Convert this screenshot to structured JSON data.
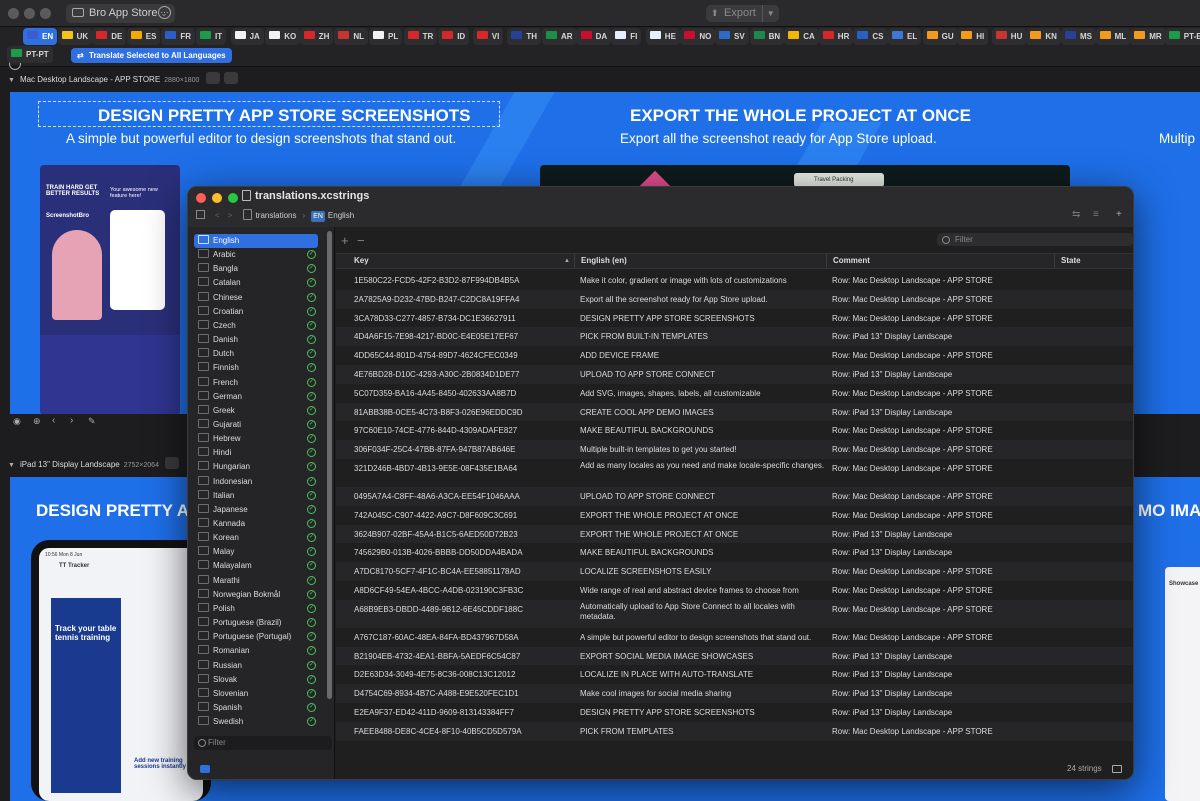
{
  "app": {
    "project_name": "Bro App Store",
    "export_label": "Export"
  },
  "languages": [
    {
      "code": "EN",
      "color": "#3c5bd0",
      "active": true
    },
    {
      "code": "UK",
      "color": "#f0c419"
    },
    {
      "code": "DE",
      "color": "#d62828"
    },
    {
      "code": "ES",
      "color": "#f2a900"
    },
    {
      "code": "FR",
      "color": "#2a5fc8"
    },
    {
      "code": "IT",
      "color": "#1c9c4a"
    },
    {
      "code": "JA",
      "color": "#f2f2f2"
    },
    {
      "code": "KO",
      "color": "#f2f2f2"
    },
    {
      "code": "ZH",
      "color": "#d62828"
    },
    {
      "code": "NL",
      "color": "#c8352f"
    },
    {
      "code": "PL",
      "color": "#f2f2f2"
    },
    {
      "code": "TR",
      "color": "#d62828"
    },
    {
      "code": "ID",
      "color": "#d62828"
    },
    {
      "code": "VI",
      "color": "#d62828"
    },
    {
      "code": "TH",
      "color": "#2a3f99"
    },
    {
      "code": "AR",
      "color": "#1c8f47"
    },
    {
      "code": "DA",
      "color": "#c8102e"
    },
    {
      "code": "FI",
      "color": "#e6eefc"
    },
    {
      "code": "HE",
      "color": "#e6eefc"
    },
    {
      "code": "NO",
      "color": "#c8102e"
    },
    {
      "code": "SV",
      "color": "#2a6cc8"
    },
    {
      "code": "BN",
      "color": "#1b8a4c"
    },
    {
      "code": "CA",
      "color": "#f2b705"
    },
    {
      "code": "HR",
      "color": "#d62828"
    },
    {
      "code": "CS",
      "color": "#2a5fc8"
    },
    {
      "code": "EL",
      "color": "#3d78d8"
    },
    {
      "code": "GU",
      "color": "#f29a1d"
    },
    {
      "code": "HI",
      "color": "#f29a1d"
    },
    {
      "code": "HU",
      "color": "#c8352f"
    },
    {
      "code": "KN",
      "color": "#f29a1d"
    },
    {
      "code": "MS",
      "color": "#2a3f99"
    },
    {
      "code": "ML",
      "color": "#f29a1d"
    },
    {
      "code": "MR",
      "color": "#f29a1d"
    },
    {
      "code": "PT-BR",
      "color": "#1c9c4a"
    },
    {
      "code": "PT-PT",
      "color": "#1c9c4a"
    }
  ],
  "translate_button": "Translate Selected to All Languages",
  "rows": [
    {
      "title": "Mac Desktop Landscape - APP STORE",
      "dims": "2880×1800"
    },
    {
      "title": "iPad 13\" Display Landscape",
      "dims": "2752×2064"
    }
  ],
  "mac_strip": {
    "slide1_title": "DESIGN PRETTY APP STORE SCREENSHOTS",
    "slide1_sub": "A simple but powerful editor to design screenshots that stand out.",
    "slide2_title": "EXPORT THE WHOLE PROJECT AT ONCE",
    "slide2_sub": "Export all the screenshot ready for App Store upload.",
    "slide3_sub": "Multip",
    "mock_card1": "TRAIN HARD GET BETTER RESULTS",
    "mock_card2": "Your awesome new feature here!",
    "mock_brand": "ScreenshotBro",
    "travel_tab": "Travel Packing"
  },
  "ipad_strip": {
    "slide1_title": "DESIGN PRETTY A",
    "slide3_title": "MO IMAG",
    "ipad_time": "10:56  Mon 8 Jun",
    "ipad_app": "TT Tracker",
    "ipad_headline": "Track your table tennis training",
    "ipad_sub": "Add new training sessions instantly",
    "side_title": "Showcase"
  },
  "window": {
    "file_name": "translations.xcstrings",
    "breadcrumb_root": "translations",
    "breadcrumb_lang": "English",
    "filter_placeholder": "Filter",
    "sidebar_filter_placeholder": "Filter",
    "string_count": "24 strings",
    "columns": [
      "Key",
      "English (en)",
      "Comment",
      "State"
    ],
    "sidebar_languages": [
      "English",
      "Arabic",
      "Bangla",
      "Catalan",
      "Chinese",
      "Croatian",
      "Czech",
      "Danish",
      "Dutch",
      "Finnish",
      "French",
      "German",
      "Greek",
      "Gujarati",
      "Hebrew",
      "Hindi",
      "Hungarian",
      "Indonesian",
      "Italian",
      "Japanese",
      "Kannada",
      "Korean",
      "Malay",
      "Malayalam",
      "Marathi",
      "Norwegian Bokmål",
      "Polish",
      "Portuguese (Brazil)",
      "Portuguese (Portugal)",
      "Romanian",
      "Russian",
      "Slovak",
      "Slovenian",
      "Spanish",
      "Swedish"
    ],
    "strings": [
      {
        "key": "1E580C22-FCD5-42F2-B3D2-87F994DB4B5A",
        "en": "Make it color, gradient or image with lots of customizations",
        "comment": "Row: Mac Desktop Landscape - APP STORE"
      },
      {
        "key": "2A7825A9-D232-47BD-B247-C2DC8A19FFA4",
        "en": "Export all the screenshot ready for App Store upload.",
        "comment": "Row: Mac Desktop Landscape - APP STORE"
      },
      {
        "key": "3CA78D33-C277-4857-B734-DC1E36627911",
        "en": "DESIGN PRETTY APP STORE SCREENSHOTS",
        "comment": "Row: Mac Desktop Landscape - APP STORE"
      },
      {
        "key": "4D4A6F15-7E98-4217-BD0C-E4E05E17EF67",
        "en": "PICK FROM BUILT-IN TEMPLATES",
        "comment": "Row: iPad 13\" Display Landscape"
      },
      {
        "key": "4DD65C44-801D-4754-89D7-4624CFEC0349",
        "en": "ADD DEVICE FRAME",
        "comment": "Row: Mac Desktop Landscape - APP STORE"
      },
      {
        "key": "4E76BD28-D10C-4293-A30C-2B0834D1DE77",
        "en": "UPLOAD TO APP STORE CONNECT",
        "comment": "Row: iPad 13\" Display Landscape"
      },
      {
        "key": "5C07D359-BA16-4A45-8450-402633AA8B7D",
        "en": "Add SVG, images, shapes, labels, all customizable",
        "comment": "Row: Mac Desktop Landscape - APP STORE"
      },
      {
        "key": "81ABB38B-0CE5-4C73-B8F3-026E96EDDC9D",
        "en": "CREATE COOL APP DEMO IMAGES",
        "comment": "Row: iPad 13\" Display Landscape"
      },
      {
        "key": "97C60E10-74CE-4776-844D-4309ADAFE827",
        "en": "MAKE BEAUTIFUL BACKGROUNDS",
        "comment": "Row: Mac Desktop Landscape - APP STORE"
      },
      {
        "key": "306F034F-25C4-47BB-87FA-947B87AB646E",
        "en": "Multiple built-in templates to get you started!",
        "comment": "Row: Mac Desktop Landscape - APP STORE"
      },
      {
        "key": "321D246B-4BD7-4B13-9E5E-08F435E1BA64",
        "en": "Add as many locales as you need and make locale-specific changes.",
        "comment": "Row: Mac Desktop Landscape - APP STORE",
        "tall": true
      },
      {
        "key": "0495A7A4-C8FF-48A6-A3CA-EE54F1046AAA",
        "en": "UPLOAD TO APP STORE CONNECT",
        "comment": "Row: Mac Desktop Landscape - APP STORE"
      },
      {
        "key": "742A045C-C907-4422-A9C7-D8F609C3C691",
        "en": "EXPORT THE WHOLE PROJECT AT ONCE",
        "comment": "Row: Mac Desktop Landscape - APP STORE"
      },
      {
        "key": "3624B907-02BF-45A4-B1C5-6AED50D72B23",
        "en": "EXPORT THE WHOLE PROJECT AT ONCE",
        "comment": "Row: iPad 13\" Display Landscape"
      },
      {
        "key": "745629B0-013B-4026-BBBB-DD50DDA4BADA",
        "en": "MAKE BEAUTIFUL BACKGROUNDS",
        "comment": "Row: iPad 13\" Display Landscape"
      },
      {
        "key": "A7DC8170-5CF7-4F1C-BC4A-EE58851178AD",
        "en": "LOCALIZE SCREENSHOTS EASILY",
        "comment": "Row: Mac Desktop Landscape - APP STORE"
      },
      {
        "key": "A8D6CF49-54EA-4BCC-A4DB-023190C3FB3C",
        "en": "Wide range of real and abstract device frames to choose from",
        "comment": "Row: Mac Desktop Landscape - APP STORE"
      },
      {
        "key": "A68B9EB3-DBDD-4489-9B12-6E45CDDF188C",
        "en": "Automatically upload to App Store Connect to all locales with metadata.",
        "comment": "Row: Mac Desktop Landscape - APP STORE",
        "tall": true
      },
      {
        "key": "A767C187-60AC-48EA-84FA-BD437967D58A",
        "en": "A simple but powerful editor to design screenshots that stand out.",
        "comment": "Row: Mac Desktop Landscape - APP STORE"
      },
      {
        "key": "B21904EB-4732-4EA1-BBFA-5AEDF6C54C87",
        "en": "EXPORT SOCIAL MEDIA IMAGE SHOWCASES",
        "comment": "Row: iPad 13\" Display Landscape"
      },
      {
        "key": "D2E63D34-3049-4E75-8C36-008C13C12012",
        "en": "LOCALIZE IN PLACE WITH AUTO-TRANSLATE",
        "comment": "Row: iPad 13\" Display Landscape"
      },
      {
        "key": "D4754C69-8934-4B7C-A488-E9E520FEC1D1",
        "en": "Make cool images for social media sharing",
        "comment": "Row: iPad 13\" Display Landscape"
      },
      {
        "key": "E2EA9F37-ED42-411D-9609-813143384FF7",
        "en": "DESIGN PRETTY APP STORE SCREENSHOTS",
        "comment": "Row: iPad 13\" Display Landscape"
      },
      {
        "key": "FAEE8488-DE8C-4CE4-8F10-40B5CD5D579A",
        "en": "PICK FROM TEMPLATES",
        "comment": "Row: Mac Desktop Landscape - APP STORE"
      }
    ]
  }
}
